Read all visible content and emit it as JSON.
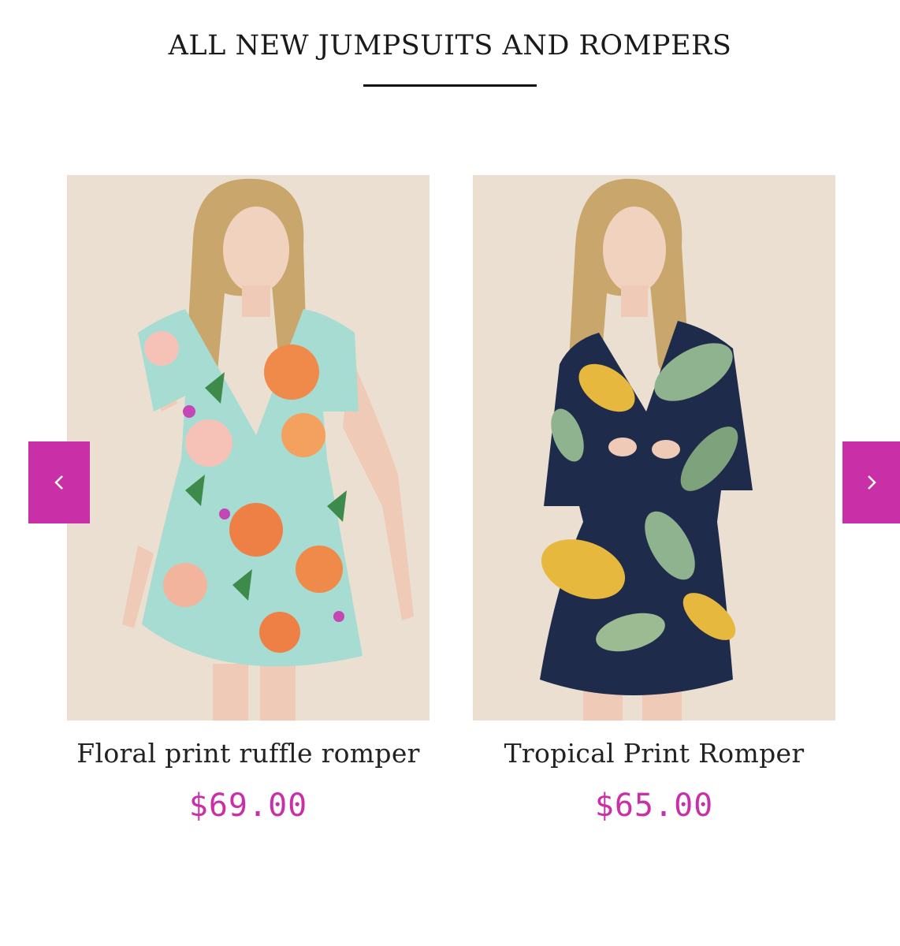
{
  "section": {
    "title": "ALL NEW JUMPSUITS AND ROMPERS"
  },
  "carousel": {
    "prev_icon": "chevron-left-icon",
    "next_icon": "chevron-right-icon",
    "products": [
      {
        "name": "Floral print ruffle romper",
        "price": "$69.00",
        "image": "floral-print-romper-photo"
      },
      {
        "name": "Tropical Print Romper",
        "price": "$65.00",
        "image": "tropical-print-romper-photo"
      }
    ]
  },
  "colors": {
    "accent": "#c930a8",
    "image_background": "#ebdfd2",
    "text": "#222222"
  }
}
